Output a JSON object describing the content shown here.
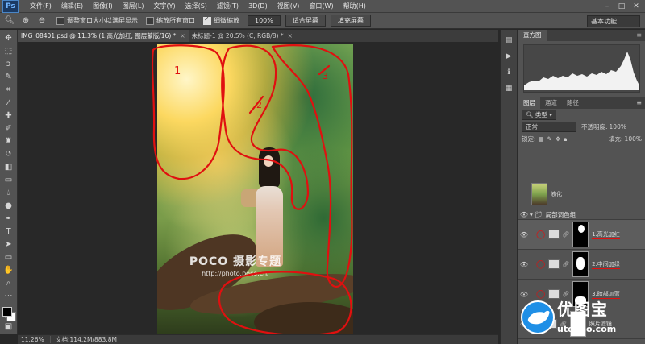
{
  "menubar": {
    "logo": "Ps",
    "items": [
      "文件(F)",
      "编辑(E)",
      "图像(I)",
      "图层(L)",
      "文字(Y)",
      "选择(S)",
      "滤镜(T)",
      "3D(D)",
      "视图(V)",
      "窗口(W)",
      "帮助(H)"
    ],
    "window_controls": [
      "–",
      "□",
      "✕"
    ]
  },
  "options_bar": {
    "resize_windows_label": "调整窗口大小以满屏显示",
    "zoom_all_label": "缩放所有窗口",
    "scrubby_zoom_label": "细微缩放",
    "zoom_value": "100%",
    "fit_screen_label": "适合屏幕",
    "fill_screen_label": "填充屏幕",
    "workspace": "基本功能"
  },
  "tabs": [
    {
      "label": "IMG_08401.psd @ 11.3% (1.高光加红, 图层蒙版/16) *",
      "close": "×"
    },
    {
      "label": "未标题-1 @ 20.5% (C, RGB/8) *",
      "close": "×"
    }
  ],
  "watermark": {
    "title": "POCO 摄影专题",
    "url": "http://photo.poco.cn/"
  },
  "annotations": {
    "num1": "1",
    "num2": "2",
    "num3": "3"
  },
  "statusbar": {
    "zoom": "11.26%",
    "doc": "文档:114.2M/883.8M"
  },
  "histogram_panel": {
    "tab": "直方图"
  },
  "layers_panel": {
    "tabs": [
      "图层",
      "通道",
      "路径"
    ],
    "filter_kind": "类型",
    "blend_mode": "正常",
    "opacity_label": "不透明度:",
    "opacity_value": "100%",
    "lock_label": "锁定:",
    "fill_label": "填充:",
    "fill_value": "100%",
    "layers": [
      {
        "name": "液化"
      },
      {
        "name": "局部调色组"
      },
      {
        "name": "1.高光加红"
      },
      {
        "name": "2.中间加绿"
      },
      {
        "name": "3.暗部加蓝"
      },
      {
        "name": "照片滤镜"
      }
    ]
  },
  "brand_logo": {
    "title": "优图宝",
    "url": "utobao.com"
  },
  "colors": {
    "annotation_red": "#e01010",
    "brand_blue": "#1f8fe6",
    "panel_bg": "#535353"
  }
}
